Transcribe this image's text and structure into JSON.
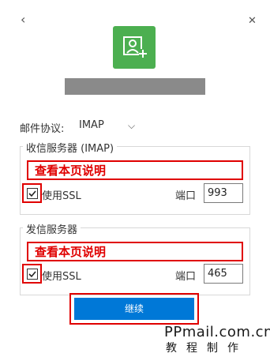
{
  "nav": {
    "back_glyph": "‹",
    "close_glyph": "✕"
  },
  "avatar": {
    "icon": "add-contact-icon",
    "color": "#4caf50"
  },
  "protocol": {
    "label": "邮件协议:",
    "value": "IMAP"
  },
  "incoming": {
    "title": "收信服务器 (IMAP)",
    "server_value": "查看本页说明",
    "ssl_label": "使用SSL",
    "ssl_checked": true,
    "port_label": "端口",
    "port_value": "993"
  },
  "outgoing": {
    "title": "发信服务器",
    "server_value": "查看本页说明",
    "ssl_label": "使用SSL",
    "ssl_checked": true,
    "port_label": "端口",
    "port_value": "465"
  },
  "continue_button": {
    "label": "继续",
    "color": "#0078d7"
  },
  "watermark": {
    "line1": "PPmail.com.cn",
    "line2": "教程制作"
  },
  "colors": {
    "highlight": "#e00000"
  }
}
